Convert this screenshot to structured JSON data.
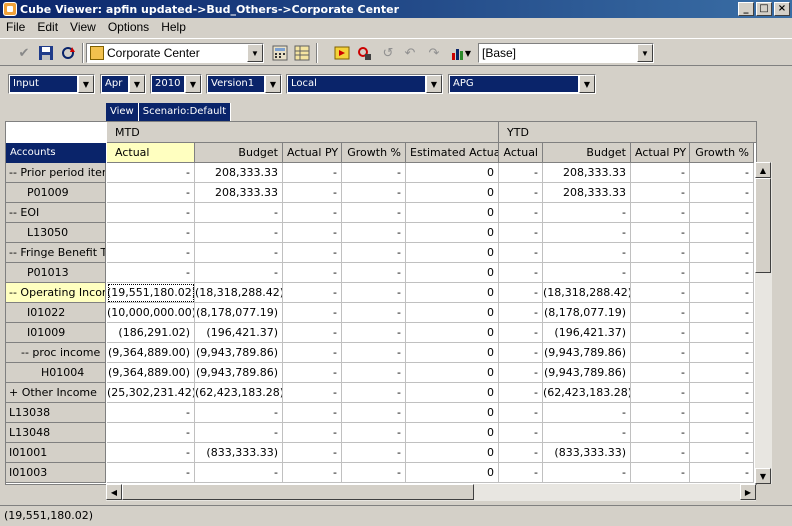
{
  "window": {
    "title": "Cube Viewer: apfin updated->Bud_Others->Corporate Center"
  },
  "menu": [
    "File",
    "Edit",
    "View",
    "Options",
    "Help"
  ],
  "toolbar": {
    "entity_combo": "Corporate Center",
    "scenario_combo": "[Base]"
  },
  "dims": [
    "Input",
    "Apr",
    "2010",
    "Version1",
    "Local",
    "APG"
  ],
  "tabs": {
    "view": "View",
    "scenario": "Scenario:Default"
  },
  "grid": {
    "accounts_label": "Accounts",
    "groups": [
      "MTD",
      "YTD"
    ],
    "columns": [
      "Actual",
      "Budget",
      "Actual PY",
      "Growth %",
      "Estimated Actual",
      "Actual",
      "Budget",
      "Actual PY",
      "Growth %"
    ],
    "rows": [
      {
        "label": "-- Prior period items",
        "values": [
          "-",
          "208,333.33",
          "-",
          "-",
          "0",
          "-",
          "208,333.33",
          "-",
          "-"
        ]
      },
      {
        "label": "P01009",
        "values": [
          "-",
          "208,333.33",
          "-",
          "-",
          "0",
          "-",
          "208,333.33",
          "-",
          "-"
        ]
      },
      {
        "label": "-- EOI",
        "values": [
          "-",
          "-",
          "-",
          "-",
          "0",
          "-",
          "-",
          "-",
          "-"
        ]
      },
      {
        "label": "L13050",
        "values": [
          "-",
          "-",
          "-",
          "-",
          "0",
          "-",
          "-",
          "-",
          "-"
        ]
      },
      {
        "label": "-- Fringe Benefit Tax",
        "values": [
          "-",
          "-",
          "-",
          "-",
          "0",
          "-",
          "-",
          "-",
          "-"
        ]
      },
      {
        "label": "P01013",
        "values": [
          "-",
          "-",
          "-",
          "-",
          "0",
          "-",
          "-",
          "-",
          "-"
        ]
      },
      {
        "label": "-- Operating Income",
        "values": [
          "(19,551,180.02)",
          "(18,318,288.42)",
          "-",
          "-",
          "0",
          "-",
          "(18,318,288.42)",
          "-",
          "-"
        ]
      },
      {
        "label": "I01022",
        "values": [
          "(10,000,000.00)",
          "(8,178,077.19)",
          "-",
          "-",
          "0",
          "-",
          "(8,178,077.19)",
          "-",
          "-"
        ]
      },
      {
        "label": "I01009",
        "values": [
          "(186,291.02)",
          "(196,421.37)",
          "-",
          "-",
          "0",
          "-",
          "(196,421.37)",
          "-",
          "-"
        ]
      },
      {
        "label": "-- proc income",
        "values": [
          "(9,364,889.00)",
          "(9,943,789.86)",
          "-",
          "-",
          "0",
          "-",
          "(9,943,789.86)",
          "-",
          "-"
        ]
      },
      {
        "label": "H01004",
        "values": [
          "(9,364,889.00)",
          "(9,943,789.86)",
          "-",
          "-",
          "0",
          "-",
          "(9,943,789.86)",
          "-",
          "-"
        ]
      },
      {
        "label": "+ Other Income",
        "values": [
          "(25,302,231.42)",
          "(62,423,183.28)",
          "-",
          "-",
          "0",
          "-",
          "(62,423,183.28)",
          "-",
          "-"
        ]
      },
      {
        "label": "L13038",
        "values": [
          "-",
          "-",
          "-",
          "-",
          "0",
          "-",
          "-",
          "-",
          "-"
        ]
      },
      {
        "label": "L13048",
        "values": [
          "-",
          "-",
          "-",
          "-",
          "0",
          "-",
          "-",
          "-",
          "-"
        ]
      },
      {
        "label": "I01001",
        "values": [
          "-",
          "(833,333.33)",
          "-",
          "-",
          "0",
          "-",
          "(833,333.33)",
          "-",
          "-"
        ]
      },
      {
        "label": "I01003",
        "values": [
          "-",
          "-",
          "-",
          "-",
          "0",
          "-",
          "-",
          "-",
          "-"
        ]
      }
    ]
  },
  "status": {
    "text": "(19,551,180.02)"
  }
}
